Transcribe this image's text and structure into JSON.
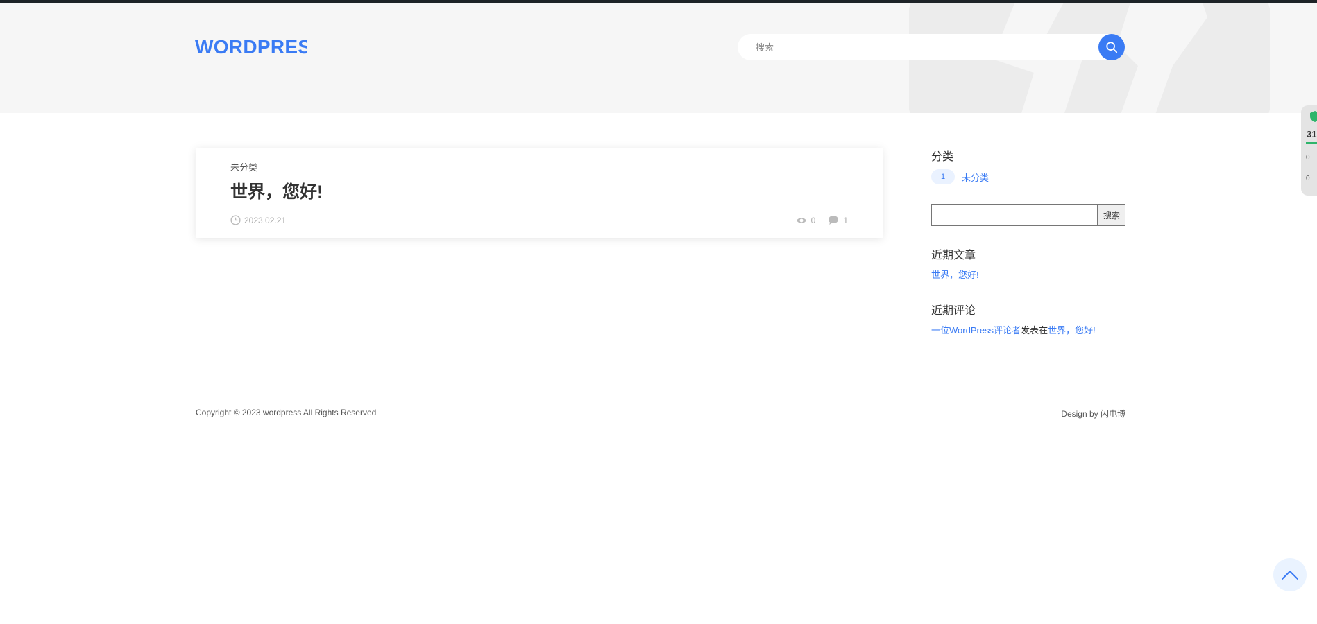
{
  "header": {
    "logo": "WORDPRESS",
    "search_placeholder": "搜索"
  },
  "post": {
    "category": "未分类",
    "title": "世界，您好!",
    "date": "2023.02.21",
    "views": "0",
    "comments": "1"
  },
  "sidebar": {
    "categories_title": "分类",
    "categories": [
      {
        "count": "1",
        "name": "未分类"
      }
    ],
    "search_button": "搜索",
    "recent_posts_title": "近期文章",
    "recent_posts": [
      "世界，您好!"
    ],
    "recent_comments_title": "近期评论",
    "recent_comment": {
      "author": "一位WordPress评论者",
      "connector": "发表在",
      "post": "世界，您好!"
    }
  },
  "footer": {
    "copyright": "Copyright © 2023 wordpress All Rights Reserved",
    "design": "Design by 闪电博"
  },
  "side_widget": {
    "number": "31",
    "stat1": "0",
    "stat2": "0"
  },
  "colors": {
    "accent": "#3a7bf4",
    "header_bg": "#f6f6f6",
    "topbar": "#1d2327"
  },
  "icons": {
    "search": "search-icon",
    "clock": "clock-icon",
    "eye": "eye-icon",
    "comment": "comment-icon",
    "back_to_top": "chevron-up-icon",
    "shield": "shield-icon"
  }
}
